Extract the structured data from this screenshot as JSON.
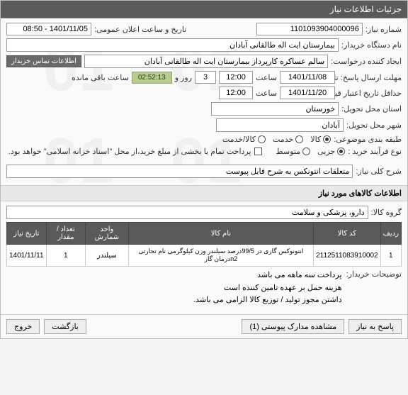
{
  "header": {
    "title": "جزئیات اطلاعات نیاز"
  },
  "fields": {
    "need_no_lbl": "شماره نیاز:",
    "need_no": "1101093904000096",
    "announce_dt_lbl": "تاریخ و ساعت اعلان عمومی:",
    "announce_dt": "1401/11/05 - 08:50",
    "buyer_org_lbl": "نام دستگاه خریدار:",
    "buyer_org": "بیمارستان ایت اله طالقانی آبادان",
    "requester_lbl": "ایجاد کننده درخواست:",
    "requester": "سالم عساکره کارپرداز بیمارستان ایت اله طالقانی آبادان",
    "contact_btn": "اطلاعات تماس خریدار",
    "deadline_lbl": "مهلت ارسال پاسخ: تا تاریخ:",
    "deadline_date": "1401/11/08",
    "time_lbl": "ساعت",
    "deadline_time": "12:00",
    "days_val": "3",
    "days_lbl": "روز و",
    "countdown": "02:52:13",
    "remain_lbl": "ساعت باقی مانده",
    "validity_lbl": "حداقل تاریخ اعتبار قیمت: تا تاریخ:",
    "validity_date": "1401/11/20",
    "validity_time": "12:00",
    "province_lbl": "استان محل تحویل:",
    "province": "خوزستان",
    "city_lbl": "شهر محل تحویل:",
    "city": "آبادان",
    "category_lbl": "طبقه بندی موضوعی:",
    "cat_goods": "کالا",
    "cat_service": "خدمت",
    "cat_goods_service": "کالا/خدمت",
    "buy_type_lbl": "نوع فرآیند خرید :",
    "buy_small": "جزیی",
    "buy_medium": "متوسط",
    "payment_note": "پرداخت تمام یا بخشی از مبلغ خرید،از محل \"اسناد خزانه اسلامی\" خواهد بود.",
    "general_desc_lbl": "شرح کلی نیاز:",
    "general_desc": "متعلقات انتونکس به شرح فایل پیوست",
    "items_title": "اطلاعات کالاهای مورد نیاز",
    "group_lbl": "گروه کالا:",
    "group_val": "دارو، پزشکی و سلامت",
    "buyer_desc_lbl": "توضیحات خریدار:",
    "buyer_desc_l1": "پرداخت سه ماهه می باشد",
    "buyer_desc_l2": "هزینه حمل بر عهده تامین کننده است",
    "buyer_desc_l3": "داشتن مجوز تولید / توزیع کالا الزامی می باشد."
  },
  "table": {
    "headers": [
      "ردیف",
      "کد کالا",
      "نام کالا",
      "واحد شمارش",
      "تعداد / مقدار",
      "تاریخ نیاز"
    ],
    "rows": [
      {
        "idx": "1",
        "code": "2112511083910002",
        "name": "انتونوکس گازی در 99/5درصد سیلندر وزن کیلوگرمی نام تجارتی n2درمان گاز",
        "unit": "سیلندر",
        "qty": "1",
        "date": "1401/11/11"
      }
    ]
  },
  "footer": {
    "reply": "پاسخ به نیاز",
    "attach": "مشاهده مدارک پیوستی (1)",
    "back": "بازگشت",
    "exit": "خروج"
  }
}
